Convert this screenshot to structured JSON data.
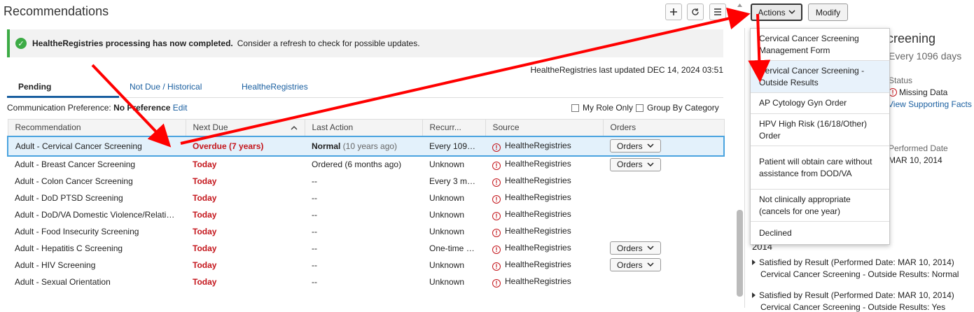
{
  "header": {
    "title": "Recommendations"
  },
  "banner": {
    "bold": "HealtheRegistries processing has now completed.",
    "text": "Consider a refresh to check for possible updates."
  },
  "last_updated": "HealtheRegistries last updated DEC 14, 2024 03:51",
  "tabs": [
    {
      "label": "Pending"
    },
    {
      "label": "Not Due / Historical"
    },
    {
      "label": "HealtheRegistries"
    }
  ],
  "comm_pref": {
    "label": "Communication Preference:",
    "value": "No Preference",
    "edit": "Edit"
  },
  "filters": {
    "my_role_only": "My Role Only",
    "group_by_category": "Group By Category"
  },
  "columns": [
    "Recommendation",
    "Next Due",
    "Last Action",
    "Recurr...",
    "Source",
    "Orders"
  ],
  "rows": [
    {
      "rec": "Adult - Cervical Cancer Screening",
      "due": "Overdue (7 years)",
      "last_bold": "Normal",
      "last": " (10 years ago)",
      "recur": "Every 1096 ...",
      "source": "HealtheRegistries",
      "orders": "Orders"
    },
    {
      "rec": "Adult - Breast Cancer Screening",
      "due": "Today",
      "last_bold": "",
      "last": "Ordered (6 months ago)",
      "recur": "Unknown",
      "source": "HealtheRegistries",
      "orders": "Orders"
    },
    {
      "rec": "Adult - Colon Cancer Screening",
      "due": "Today",
      "last_bold": "",
      "last": "--",
      "recur": "Every 3 mon...",
      "source": "HealtheRegistries",
      "orders": ""
    },
    {
      "rec": "Adult - DoD PTSD Screening",
      "due": "Today",
      "last_bold": "",
      "last": "--",
      "recur": "Unknown",
      "source": "HealtheRegistries",
      "orders": ""
    },
    {
      "rec": "Adult - DoD/VA Domestic Violence/Relation...",
      "due": "Today",
      "last_bold": "",
      "last": "--",
      "recur": "Unknown",
      "source": "HealtheRegistries",
      "orders": ""
    },
    {
      "rec": "Adult - Food Insecurity Screening",
      "due": "Today",
      "last_bold": "",
      "last": "--",
      "recur": "Unknown",
      "source": "HealtheRegistries",
      "orders": ""
    },
    {
      "rec": "Adult - Hepatitis C Screening",
      "due": "Today",
      "last_bold": "",
      "last": "--",
      "recur": "One-time only",
      "source": "HealtheRegistries",
      "orders": "Orders"
    },
    {
      "rec": "Adult - HIV Screening",
      "due": "Today",
      "last_bold": "",
      "last": "--",
      "recur": "Unknown",
      "source": "HealtheRegistries",
      "orders": "Orders"
    },
    {
      "rec": "Adult - Sexual Orientation",
      "due": "Today",
      "last_bold": "",
      "last": "--",
      "recur": "Unknown",
      "source": "HealtheRegistries",
      "orders": ""
    }
  ],
  "actions": {
    "button": "Actions",
    "modify": "Modify",
    "menu": [
      "Cervical Cancer Screening Management Form",
      "Cervical Cancer Screening - Outside Results",
      "AP Cytology Gyn Order",
      "HPV High Risk (16/18/Other) Order",
      "Patient will obtain care without assistance from DOD/VA",
      "Not clinically appropriate (cancels for one year)",
      "Declined"
    ]
  },
  "side_panel": {
    "title_fragment": "creening",
    "recur_fragment": "Every 1096 days",
    "status_label": "Status",
    "status_value": "Missing Data",
    "view_facts": "View Supporting Facts",
    "performed_label": "Performed Date",
    "performed_value": "MAR 10, 2014",
    "year": "2014",
    "sat1": "Satisfied by Result (Performed Date: MAR 10, 2014)",
    "sat1_sub": "Cervical Cancer Screening - Outside Results: Normal",
    "sat2": "Satisfied by Result (Performed Date: MAR 10, 2014)",
    "sat2_sub": "Cervical Cancer Screening - Outside Results: Yes"
  },
  "colors": {
    "accent": "#1a5fa0",
    "overdue": "#c4161c",
    "success": "#3cab45",
    "annotation": "#ff0000"
  }
}
